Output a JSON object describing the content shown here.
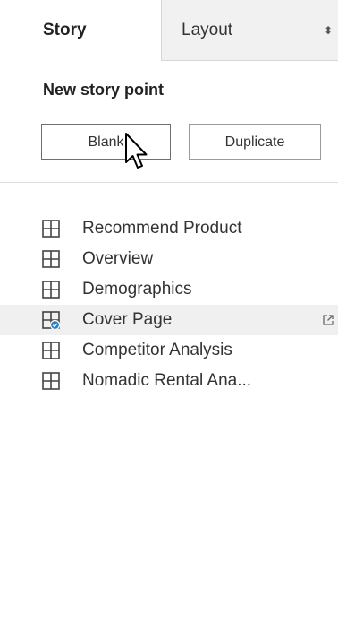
{
  "tabs": {
    "story_label": "Story",
    "layout_label": "Layout",
    "arrows_icon": "up-down-arrows-icon"
  },
  "new_story_point": {
    "heading": "New story point",
    "blank_label": "Blank",
    "duplicate_label": "Duplicate"
  },
  "story_points": [
    {
      "label": "Recommend Product",
      "icon": "sheet-grid-icon",
      "selected": false
    },
    {
      "label": "Overview",
      "icon": "sheet-grid-icon",
      "selected": false
    },
    {
      "label": "Demographics",
      "icon": "sheet-grid-icon",
      "selected": false
    },
    {
      "label": "Cover Page",
      "icon": "sheet-grid-check-icon",
      "selected": true
    },
    {
      "label": "Competitor Analysis",
      "icon": "sheet-grid-icon",
      "selected": false
    },
    {
      "label": "Nomadic Rental Ana...",
      "icon": "sheet-grid-icon",
      "selected": false
    }
  ],
  "colors": {
    "selected_row_bg": "#f0f0f0",
    "check_badge": "#2f7fc1",
    "text": "#333333"
  }
}
